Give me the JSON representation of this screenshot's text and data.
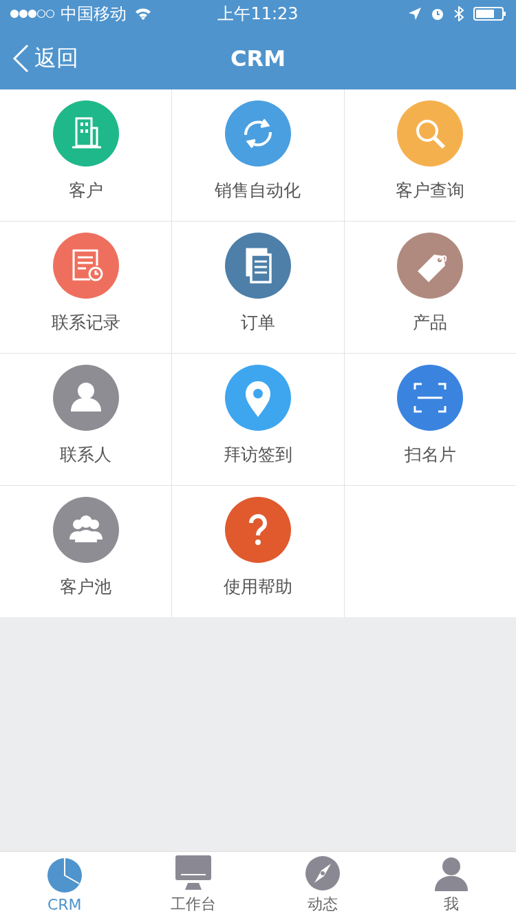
{
  "status_bar": {
    "carrier": "中国移动",
    "time": "上午11:23"
  },
  "nav": {
    "back": "返回",
    "title": "CRM"
  },
  "tiles": [
    {
      "label": "客户",
      "kind": "building",
      "color": "#1fb88a"
    },
    {
      "label": "销售自动化",
      "kind": "sync",
      "color": "#4a9fe0"
    },
    {
      "label": "客户查询",
      "kind": "search",
      "color": "#f5b04e"
    },
    {
      "label": "联系记录",
      "kind": "record",
      "color": "#ef6f5e"
    },
    {
      "label": "订单",
      "kind": "document",
      "color": "#4d7fa8"
    },
    {
      "label": "产品",
      "kind": "tag",
      "color": "#b08a7e"
    },
    {
      "label": "联系人",
      "kind": "person",
      "color": "#8e8d94"
    },
    {
      "label": "拜访签到",
      "kind": "pin",
      "color": "#3ea6ef"
    },
    {
      "label": "扫名片",
      "kind": "scan",
      "color": "#3a84e0"
    },
    {
      "label": "客户池",
      "kind": "group",
      "color": "#8e8d94"
    },
    {
      "label": "使用帮助",
      "kind": "help",
      "color": "#e05a2e"
    }
  ],
  "tabbar": [
    {
      "label": "CRM",
      "kind": "pie",
      "selected": true
    },
    {
      "label": "工作台",
      "kind": "monitor",
      "selected": false
    },
    {
      "label": "动态",
      "kind": "compass",
      "selected": false
    },
    {
      "label": "我",
      "kind": "profile",
      "selected": false
    }
  ]
}
